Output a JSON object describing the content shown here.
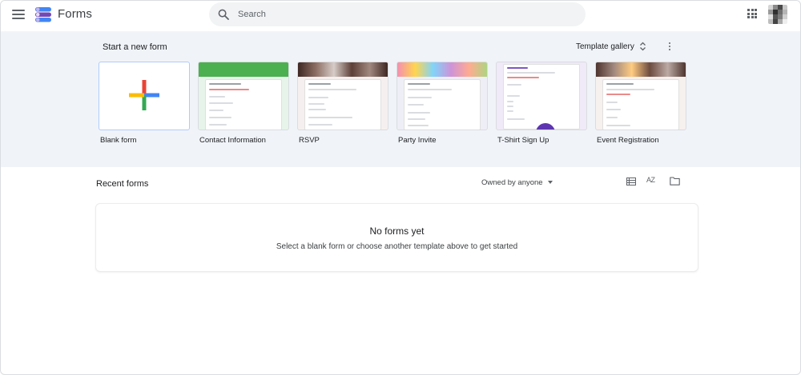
{
  "header": {
    "app_title": "Forms",
    "search_placeholder": "Search"
  },
  "templates_section": {
    "title": "Start a new form",
    "gallery_label": "Template gallery",
    "templates": [
      {
        "label": "Blank form",
        "icon": "plus-icon"
      },
      {
        "label": "Contact Information",
        "thumb_color": "#4caf50",
        "thumb_bg": "#e6f4ea",
        "mini_title": "Contact information"
      },
      {
        "label": "RSVP",
        "thumb_color": "#6d4c41",
        "thumb_bg": "#f5f0ef",
        "mini_title": "Event RSVP"
      },
      {
        "label": "Party Invite",
        "thumb_color": "#f48fb1",
        "thumb_bg": "#eeeef6",
        "mini_title": "Party Invite"
      },
      {
        "label": "T-Shirt Sign Up",
        "thumb_color": "#7e57c2",
        "thumb_bg": "#efe9f8",
        "mini_title": "T-Shirt Sign Up"
      },
      {
        "label": "Event Registration",
        "thumb_color": "#8d6e63",
        "thumb_bg": "#f6f0ee",
        "mini_title": "Event registration"
      }
    ]
  },
  "recent_section": {
    "title": "Recent forms",
    "owner_filter": "Owned by anyone",
    "sort_icon_text": "AZ",
    "empty_title": "No forms yet",
    "empty_subtitle": "Select a blank form or choose another template above to get started"
  },
  "colors": {
    "band_bg": "#f0f4f9",
    "search_bg": "#f1f3f4",
    "google_blue": "#4285f4",
    "google_red": "#ea4335",
    "google_yellow": "#fbbc04",
    "google_green": "#34a853",
    "forms_purple": "#7248b9"
  }
}
